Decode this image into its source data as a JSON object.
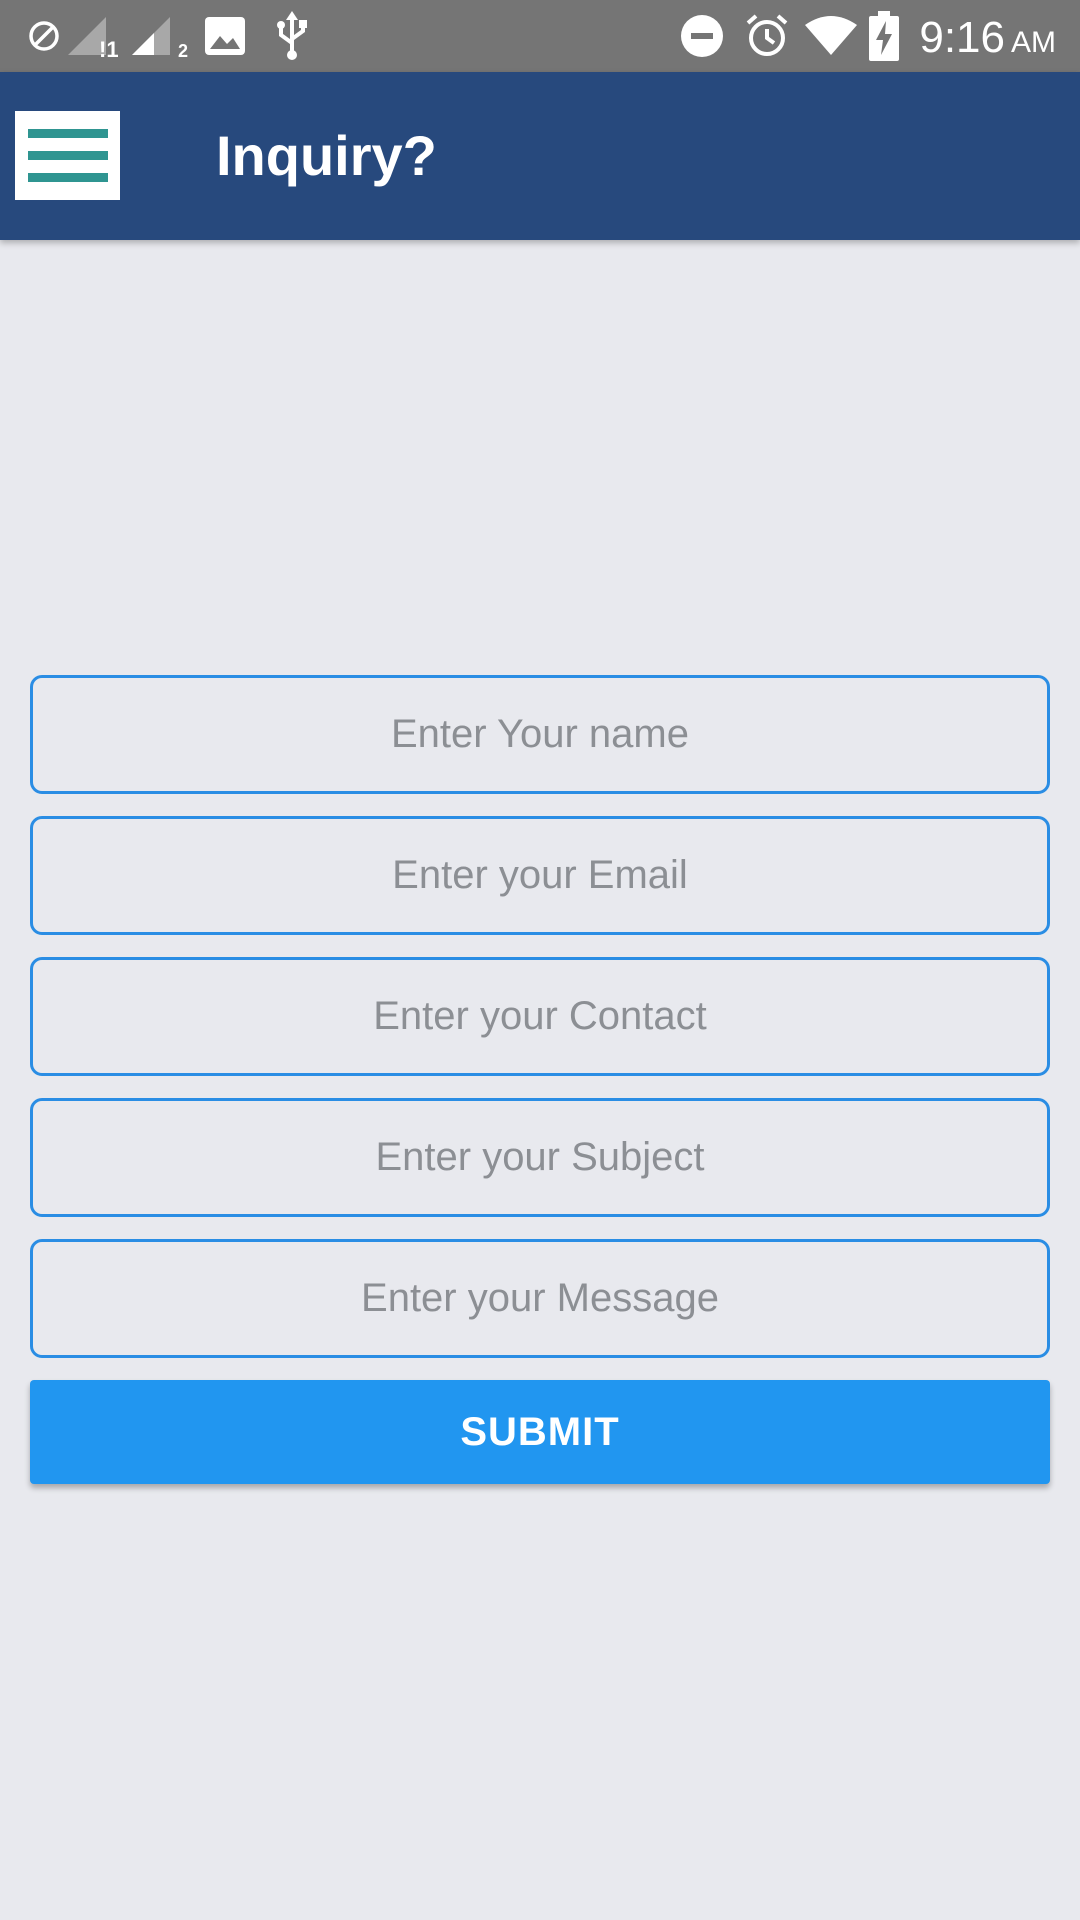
{
  "status_bar": {
    "time": "9:16",
    "ampm": "AM",
    "icons": [
      "do-not-disturb-off-icon",
      "signal-sim1-icon",
      "signal-sim2-icon",
      "image-icon",
      "usb-icon",
      "do-not-disturb-icon",
      "alarm-icon",
      "wifi-icon",
      "battery-charging-icon"
    ],
    "sim1_label": "!1",
    "sim2_label": "2"
  },
  "app_bar": {
    "title": "Inquiry?",
    "menu_icon": "hamburger-menu-icon"
  },
  "form": {
    "fields": [
      {
        "placeholder": "Enter Your name",
        "value": ""
      },
      {
        "placeholder": "Enter your Email",
        "value": ""
      },
      {
        "placeholder": "Enter your Contact",
        "value": ""
      },
      {
        "placeholder": "Enter your Subject",
        "value": ""
      },
      {
        "placeholder": "Enter your Message",
        "value": ""
      }
    ],
    "submit_label": "SUBMIT"
  },
  "colors": {
    "app_bar": "#27497d",
    "status_bar": "#757575",
    "menu_lines": "#2f9591",
    "field_border": "#2a8de4",
    "submit": "#2196f0",
    "background": "#e8e9ee"
  }
}
